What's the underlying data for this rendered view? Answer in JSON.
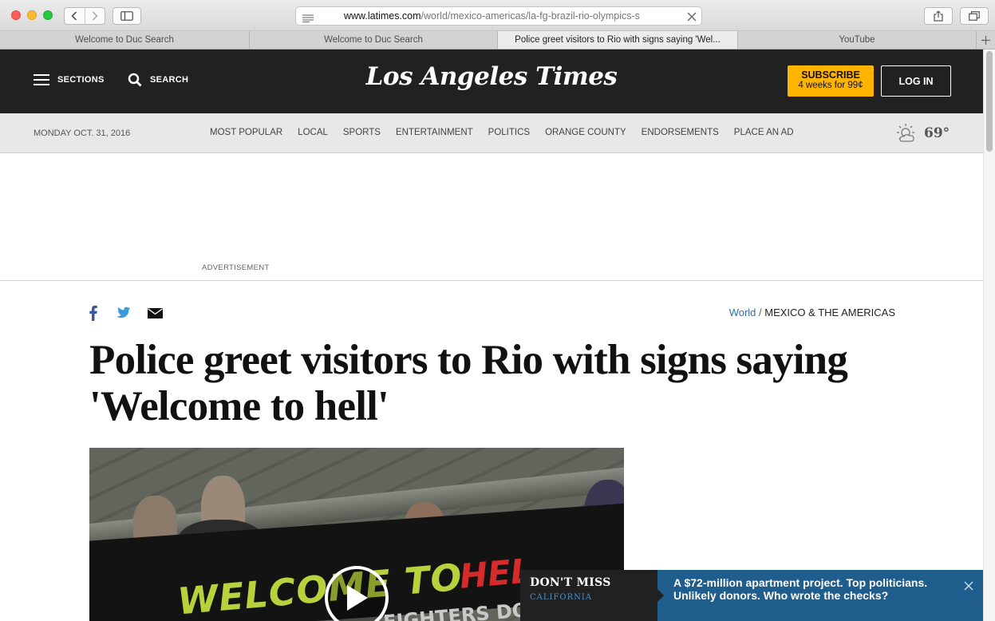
{
  "browser": {
    "url_host": "www.latimes.com",
    "url_path": "/world/mexico-americas/la-fg-brazil-rio-olympics-s",
    "tabs": [
      {
        "label": "Welcome to Duc Search"
      },
      {
        "label": "Welcome to Duc Search"
      },
      {
        "label": "Police greet visitors to Rio with signs saying 'Wel..."
      },
      {
        "label": "YouTube"
      }
    ]
  },
  "header": {
    "sections_label": "SECTIONS",
    "search_label": "SEARCH",
    "logo_text": "Los Angeles Times",
    "subscribe_title": "SUBSCRIBE",
    "subscribe_offer": "4 weeks for 99¢",
    "login_label": "LOG IN"
  },
  "subnav": {
    "date": "MONDAY OCT. 31, 2016",
    "links": [
      "MOST POPULAR",
      "LOCAL",
      "SPORTS",
      "ENTERTAINMENT",
      "POLITICS",
      "ORANGE COUNTY",
      "ENDORSEMENTS",
      "PLACE AN AD"
    ],
    "temperature": "69°"
  },
  "ad": {
    "label": "ADVERTISEMENT"
  },
  "article": {
    "breadcrumb_world": "World",
    "breadcrumb_sep": " / ",
    "breadcrumb_section": "MEXICO & THE AMERICAS",
    "headline": "Police greet visitors to Rio with signs saying 'Welcome to hell'",
    "image_banner_text": "WELCOME TO",
    "image_banner_red": "HEL",
    "image_banner_sub": "FIGHTERS DON'T"
  },
  "dont_miss": {
    "title": "DON'T MISS",
    "category": "CALIFORNIA",
    "story": "A $72-million apartment project. Top politicians. Unlikely donors. Who wrote the checks?"
  },
  "colors": {
    "header_bg": "#212121",
    "subscribe_bg": "#ffb400",
    "link_blue": "#2a6fb4",
    "dont_miss_blue": "#1f5d8c"
  }
}
